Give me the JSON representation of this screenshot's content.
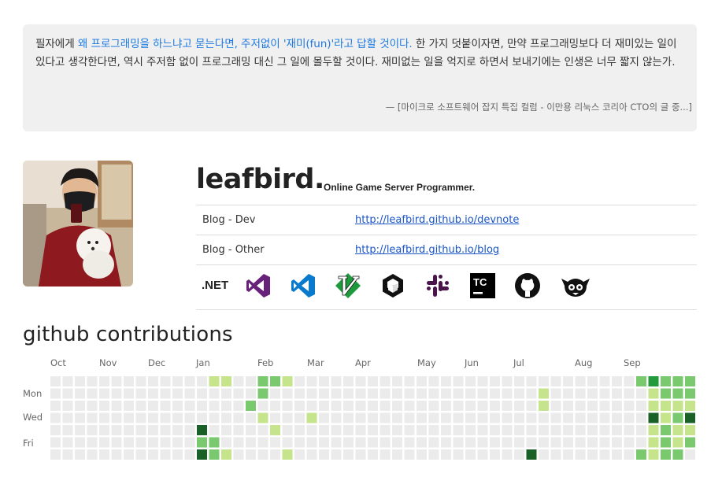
{
  "quote": {
    "text_before": "필자에게 ",
    "highlight": "왜 프로그래밍을 하느냐고 묻는다면, 주저없이 '재미(fun)'라고 답할 것이다.",
    "text_after": " 한 가지 덧붙이자면, 만약 프로그래밍보다 더 재미있는 일이 있다고 생각한다면, 역시 주저함 없이 프로그래밍 대신 그 일에 몰두할 것이다. 재미없는 일을 억지로 하면서 보내기에는 인생은 너무 짧지 않는가.",
    "source": "—  [마이크로 소프트웨어 잡지 특집 컬럼 - 이만용 리눅스 코리아 CTO의 글 중...]"
  },
  "profile": {
    "name": "leafbird.",
    "tagline": "Online Game Server Programmer.",
    "links": [
      {
        "label": "Blog - Dev",
        "url": "http://leafbird.github.io/devnote"
      },
      {
        "label": "Blog - Other",
        "url": "http://leafbird.github.io/blog"
      }
    ],
    "net_label": ".NET",
    "icons": [
      "dotnet-icon",
      "visual-studio-icon",
      "vscode-icon",
      "vim-icon",
      "unity-icon",
      "slack-icon",
      "teamcity-icon",
      "github-icon",
      "yeoman-icon"
    ]
  },
  "github": {
    "title": "github contributions",
    "months": [
      "Oct",
      "Nov",
      "Dec",
      "Jan",
      "Feb",
      "Mar",
      "Apr",
      "May",
      "Jun",
      "Jul",
      "Aug",
      "Sep"
    ],
    "day_labels": [
      "Mon",
      "Wed",
      "Fri"
    ],
    "colors": {
      "empty": "#ebebeb",
      "l1": "#c6e48b",
      "l2": "#7bc96f",
      "l3": "#239a3b",
      "l4": "#196127"
    },
    "contributions": [
      {
        "week": 13,
        "day": 0,
        "level": 1
      },
      {
        "week": 13,
        "day": 5,
        "level": 2
      },
      {
        "week": 13,
        "day": 6,
        "level": 2
      },
      {
        "week": 12,
        "day": 4,
        "level": 4
      },
      {
        "week": 12,
        "day": 5,
        "level": 2
      },
      {
        "week": 12,
        "day": 6,
        "level": 4
      },
      {
        "week": 14,
        "day": 0,
        "level": 1
      },
      {
        "week": 14,
        "day": 6,
        "level": 1
      },
      {
        "week": 16,
        "day": 2,
        "level": 2
      },
      {
        "week": 17,
        "day": 0,
        "level": 2
      },
      {
        "week": 17,
        "day": 1,
        "level": 2
      },
      {
        "week": 17,
        "day": 3,
        "level": 1
      },
      {
        "week": 18,
        "day": 0,
        "level": 2
      },
      {
        "week": 18,
        "day": 4,
        "level": 1
      },
      {
        "week": 19,
        "day": 0,
        "level": 1
      },
      {
        "week": 19,
        "day": 6,
        "level": 1
      },
      {
        "week": 21,
        "day": 3,
        "level": 1
      },
      {
        "week": 40,
        "day": 1,
        "level": 1
      },
      {
        "week": 40,
        "day": 2,
        "level": 1
      },
      {
        "week": 39,
        "day": 6,
        "level": 4
      },
      {
        "week": 48,
        "day": 0,
        "level": 2
      },
      {
        "week": 48,
        "day": 6,
        "level": 2
      },
      {
        "week": 49,
        "day": 0,
        "level": 3
      },
      {
        "week": 49,
        "day": 1,
        "level": 1
      },
      {
        "week": 49,
        "day": 2,
        "level": 1
      },
      {
        "week": 49,
        "day": 3,
        "level": 4
      },
      {
        "week": 49,
        "day": 4,
        "level": 1
      },
      {
        "week": 49,
        "day": 5,
        "level": 1
      },
      {
        "week": 49,
        "day": 6,
        "level": 1
      },
      {
        "week": 50,
        "day": 0,
        "level": 2
      },
      {
        "week": 50,
        "day": 1,
        "level": 2
      },
      {
        "week": 50,
        "day": 2,
        "level": 1
      },
      {
        "week": 50,
        "day": 3,
        "level": 1
      },
      {
        "week": 50,
        "day": 4,
        "level": 2
      },
      {
        "week": 50,
        "day": 5,
        "level": 2
      },
      {
        "week": 50,
        "day": 6,
        "level": 2
      },
      {
        "week": 51,
        "day": 0,
        "level": 2
      },
      {
        "week": 51,
        "day": 1,
        "level": 2
      },
      {
        "week": 51,
        "day": 2,
        "level": 1
      },
      {
        "week": 51,
        "day": 3,
        "level": 2
      },
      {
        "week": 51,
        "day": 4,
        "level": 1
      },
      {
        "week": 51,
        "day": 5,
        "level": 1
      },
      {
        "week": 51,
        "day": 6,
        "level": 2
      },
      {
        "week": 52,
        "day": 0,
        "level": 2
      },
      {
        "week": 52,
        "day": 1,
        "level": 2
      },
      {
        "week": 52,
        "day": 2,
        "level": 1
      },
      {
        "week": 52,
        "day": 3,
        "level": 4
      },
      {
        "week": 52,
        "day": 4,
        "level": 1
      },
      {
        "week": 52,
        "day": 5,
        "level": 2
      }
    ]
  }
}
